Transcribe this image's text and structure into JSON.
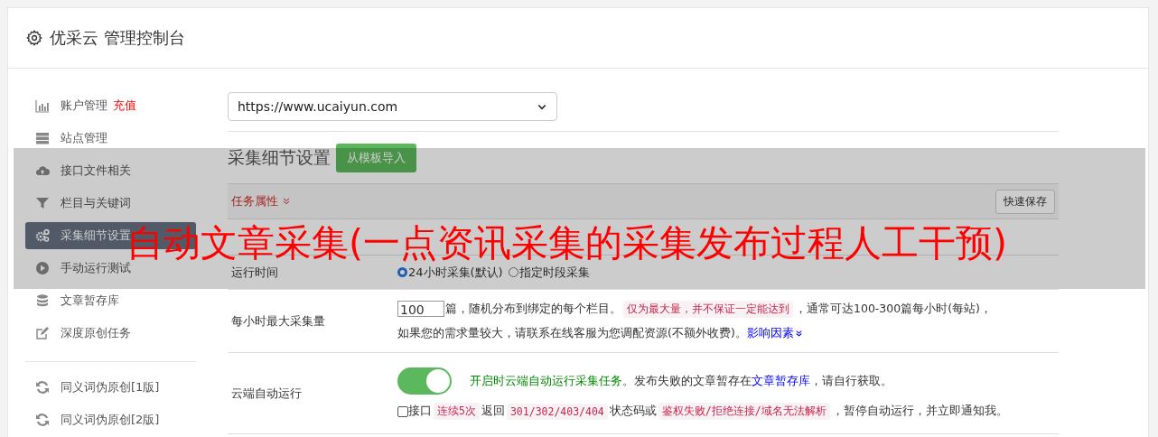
{
  "header": {
    "title": "优采云 管理控制台"
  },
  "sidebar": {
    "items": [
      {
        "label": "账户管理",
        "badge": "充值",
        "selected": false
      },
      {
        "label": "站点管理",
        "selected": false
      },
      {
        "label": "接口文件相关",
        "selected": false
      },
      {
        "label": "栏目与关键词",
        "selected": false
      },
      {
        "label": "采集细节设置",
        "selected": true
      },
      {
        "label": "手动运行测试",
        "selected": false
      },
      {
        "label": "文章暂存库",
        "selected": false
      },
      {
        "label": "深度原创任务",
        "selected": false
      },
      {
        "kind": "divider"
      },
      {
        "label": "同义词伪原创[1版]",
        "selected": false
      },
      {
        "label": "同义词伪原创[2版]",
        "selected": false
      }
    ]
  },
  "site_select": {
    "value": "https://www.ucaiyun.com"
  },
  "section": {
    "title": "采集细节设置",
    "button": "从模板导入"
  },
  "panel": {
    "heading": "任务属性",
    "save_button": "快速保存",
    "rows": [
      {
        "kind": "field"
      },
      {
        "kind": "radio",
        "label": "运行时间",
        "options": [
          {
            "label": "24小时采集(默认)",
            "selected": true
          },
          {
            "label": "指定时段采集",
            "selected": false
          }
        ]
      },
      {
        "kind": "amount",
        "label": "每小时最大采集量",
        "value": "100",
        "line1": [
          {
            "kind": "text",
            "s": "篇，随机分布到绑定的每个栏目。"
          },
          {
            "kind": "code",
            "s": "仅为最大量，并不保证一定能达到"
          },
          {
            "kind": "text",
            "s": "，通常可达100-300篇每小时(每站)，"
          }
        ],
        "line2": [
          {
            "kind": "text",
            "s": "如果您的需求量较大，请联系在线客服为您调配资源(不额外收费)。"
          },
          {
            "kind": "link",
            "s": "影响因素"
          }
        ]
      },
      {
        "kind": "toggle",
        "label": "云端自动运行",
        "on": true,
        "line1": [
          {
            "kind": "green",
            "s": "开启时云端自动运行采集任务"
          },
          {
            "kind": "text",
            "s": "。发布失败的文章暂存在"
          },
          {
            "kind": "link",
            "s": "文章暂存库"
          },
          {
            "kind": "text",
            "s": "，请自行获取。"
          }
        ],
        "checkbox": {
          "checked": false,
          "label": "接口"
        },
        "line2": [
          {
            "kind": "code",
            "s": "连续5次"
          },
          {
            "kind": "text",
            "s": "返回"
          },
          {
            "kind": "code",
            "s": "301/302/403/404"
          },
          {
            "kind": "text",
            "s": "状态码或"
          },
          {
            "kind": "code",
            "s": "鉴权失败/拒绝连接/域名无法解析"
          },
          {
            "kind": "text",
            "s": "，暂停自动运行，并立即通知我。"
          }
        ]
      }
    ]
  },
  "overlay": {
    "title": "自动文章采集(一点资讯采集的采集发布过程人工干预)"
  }
}
